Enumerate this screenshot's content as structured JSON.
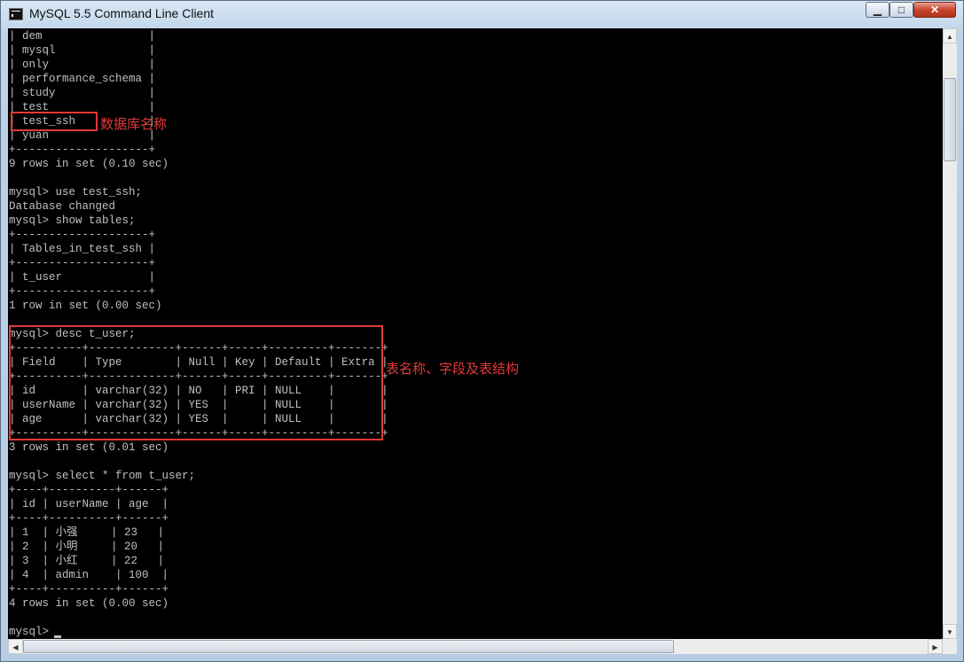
{
  "window": {
    "title": "MySQL 5.5 Command Line Client",
    "icon": "terminal-icon",
    "controls": {
      "minimize": "▁",
      "maximize": "□",
      "close": "✕"
    }
  },
  "console": {
    "text_color": "#c0c0c0",
    "background": "#000000",
    "lines": [
      "| dem                |",
      "| mysql              |",
      "| only               |",
      "| performance_schema |",
      "| study              |",
      "| test               |",
      "| test_ssh           |",
      "| yuan               |",
      "+--------------------+",
      "9 rows in set (0.10 sec)",
      "",
      "mysql> use test_ssh;",
      "Database changed",
      "mysql> show tables;",
      "+--------------------+",
      "| Tables_in_test_ssh |",
      "+--------------------+",
      "| t_user             |",
      "+--------------------+",
      "1 row in set (0.00 sec)",
      "",
      "mysql> desc t_user;",
      "+----------+-------------+------+-----+---------+-------+",
      "| Field    | Type        | Null | Key | Default | Extra |",
      "+----------+-------------+------+-----+---------+-------+",
      "| id       | varchar(32) | NO   | PRI | NULL    |       |",
      "| userName | varchar(32) | YES  |     | NULL    |       |",
      "| age      | varchar(32) | YES  |     | NULL    |       |",
      "+----------+-------------+------+-----+---------+-------+",
      "3 rows in set (0.01 sec)",
      "",
      "mysql> select * from t_user;",
      "+----+----------+------+",
      "| id | userName | age  |",
      "+----+----------+------+",
      "| 1  | 小强     | 23   |",
      "| 2  | 小明     | 20   |",
      "| 3  | 小红     | 22   |",
      "| 4  | admin    | 100  |",
      "+----+----------+------+",
      "4 rows in set (0.00 sec)",
      "",
      "mysql> "
    ]
  },
  "annotations": {
    "color": "#e23a3a",
    "db_name_label": "数据库名称",
    "table_structure_label": "表名称、字段及表结构"
  },
  "scrollbars": {
    "up": "▲",
    "down": "▼",
    "left": "◀",
    "right": "▶"
  }
}
